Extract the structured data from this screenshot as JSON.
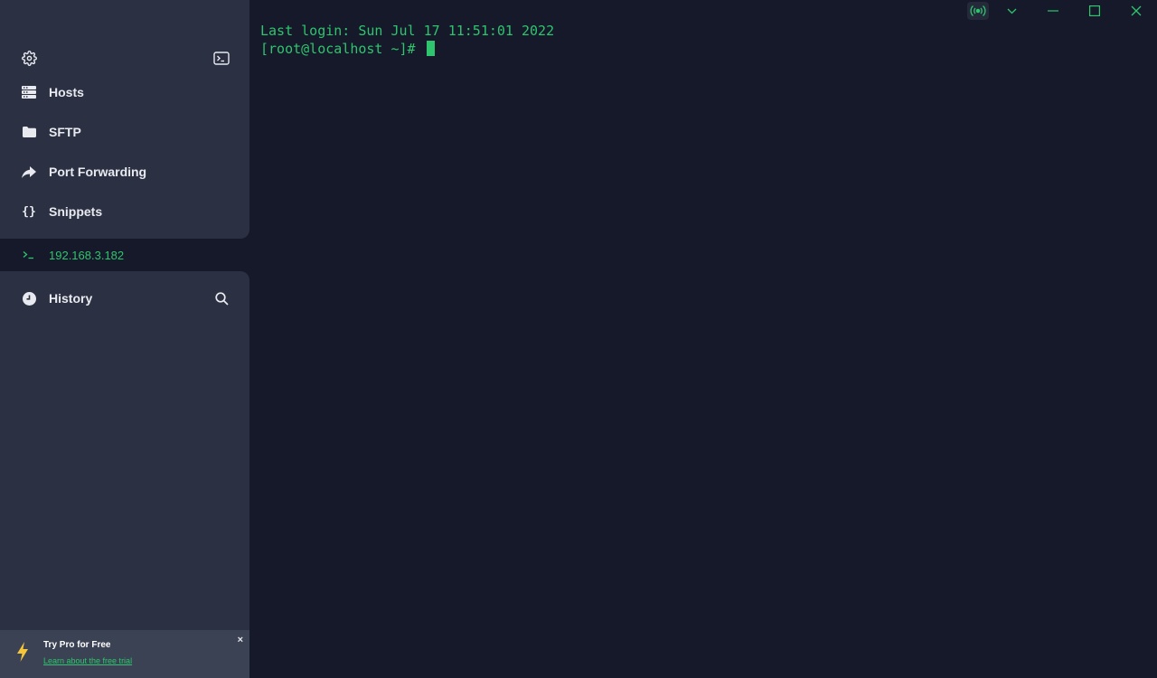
{
  "sidebar": {
    "items": [
      {
        "label": "Hosts",
        "icon": "hosts-icon"
      },
      {
        "label": "SFTP",
        "icon": "folder-icon"
      },
      {
        "label": "Port Forwarding",
        "icon": "port-forwarding-icon"
      },
      {
        "label": "Snippets",
        "icon": "braces-icon"
      }
    ],
    "session": {
      "label": "192.168.3.182",
      "icon": "terminal-prompt-icon"
    },
    "history": {
      "label": "History",
      "icon": "clock-icon"
    }
  },
  "terminal": {
    "lines": [
      "Last login: Sun Jul 17 11:51:01 2022",
      "[root@localhost ~]# "
    ]
  },
  "promo": {
    "title": "Try Pro for Free",
    "link": "Learn about the free trial",
    "close": "×"
  },
  "colors": {
    "accent": "#2fc46e",
    "sidebar_bg": "#2b3142",
    "terminal_bg": "#151929",
    "promo_bg": "#3b4254",
    "bolt": "#f5c53a"
  }
}
